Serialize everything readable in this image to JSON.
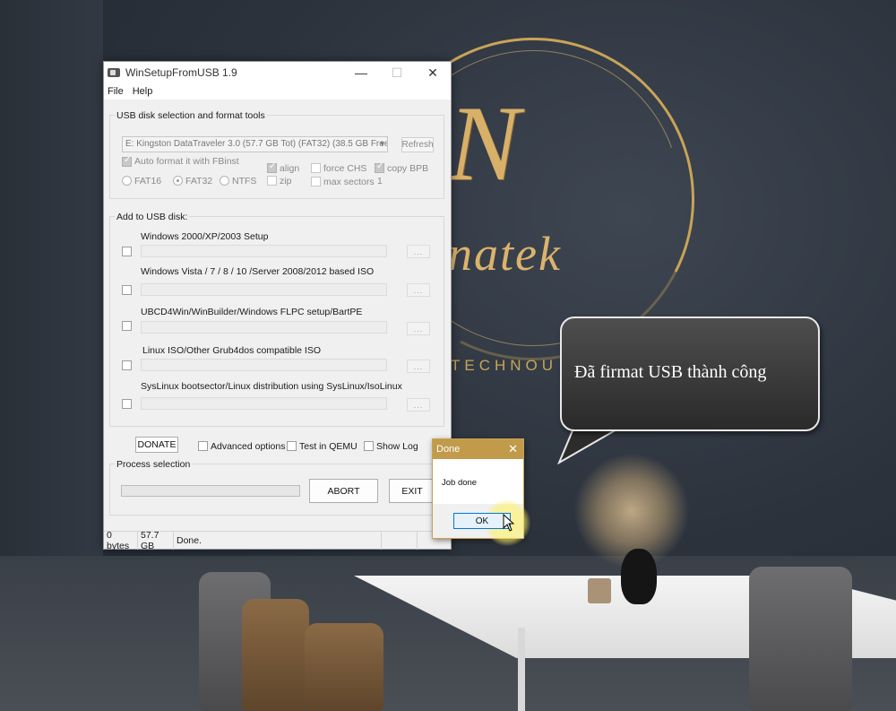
{
  "background": {
    "logo_letter": "N",
    "logo_word": "natek",
    "logo_sub": "TECHNOU"
  },
  "callout": {
    "text": "Đã firmat USB thành công"
  },
  "window": {
    "title": "WinSetupFromUSB 1.9",
    "icon": "usb-drive-icon",
    "menu": [
      "File",
      "Help"
    ],
    "usb_group_label": "USB disk selection and format tools",
    "usb_disk_selected": "E: Kingston DataTraveler 3.0 (57.7 GB Tot) (FAT32) (38.5 GB Free",
    "refresh_label": "Refresh",
    "auto_format_label": "Auto format it with FBinst",
    "format_options": {
      "fat16": "FAT16",
      "fat32": "FAT32",
      "ntfs": "NTFS",
      "align": "align",
      "zip": "zip",
      "force_chs": "force CHS",
      "max_sectors": "max sectors",
      "max_sectors_value": "1",
      "copy_bpb": "copy BPB"
    },
    "add_group_label": "Add to USB disk:",
    "sources": [
      {
        "label": "Windows 2000/XP/2003 Setup"
      },
      {
        "label": "Windows Vista / 7 / 8 / 10 /Server 2008/2012 based ISO"
      },
      {
        "label": "UBCD4Win/WinBuilder/Windows FLPC setup/BartPE"
      },
      {
        "label": "Linux ISO/Other Grub4dos compatible ISO"
      },
      {
        "label": "SysLinux bootsector/Linux distribution using SysLinux/IsoLinux"
      }
    ],
    "browse_label": "...",
    "donate_label": "DONATE",
    "advanced_options_label": "Advanced options",
    "test_qemu_label": "Test in QEMU",
    "show_log_label": "Show Log",
    "process_group_label": "Process selection",
    "abort_label": "ABORT",
    "exit_label": "EXIT",
    "status": {
      "bytes": "0 bytes",
      "size": "57.7 GB",
      "message": "Done."
    }
  },
  "dialog": {
    "title": "Done",
    "message": "Job done",
    "ok_label": "OK"
  },
  "colors": {
    "dialog_title": "#c19a4a",
    "logo_gold": "#d8b06a"
  }
}
